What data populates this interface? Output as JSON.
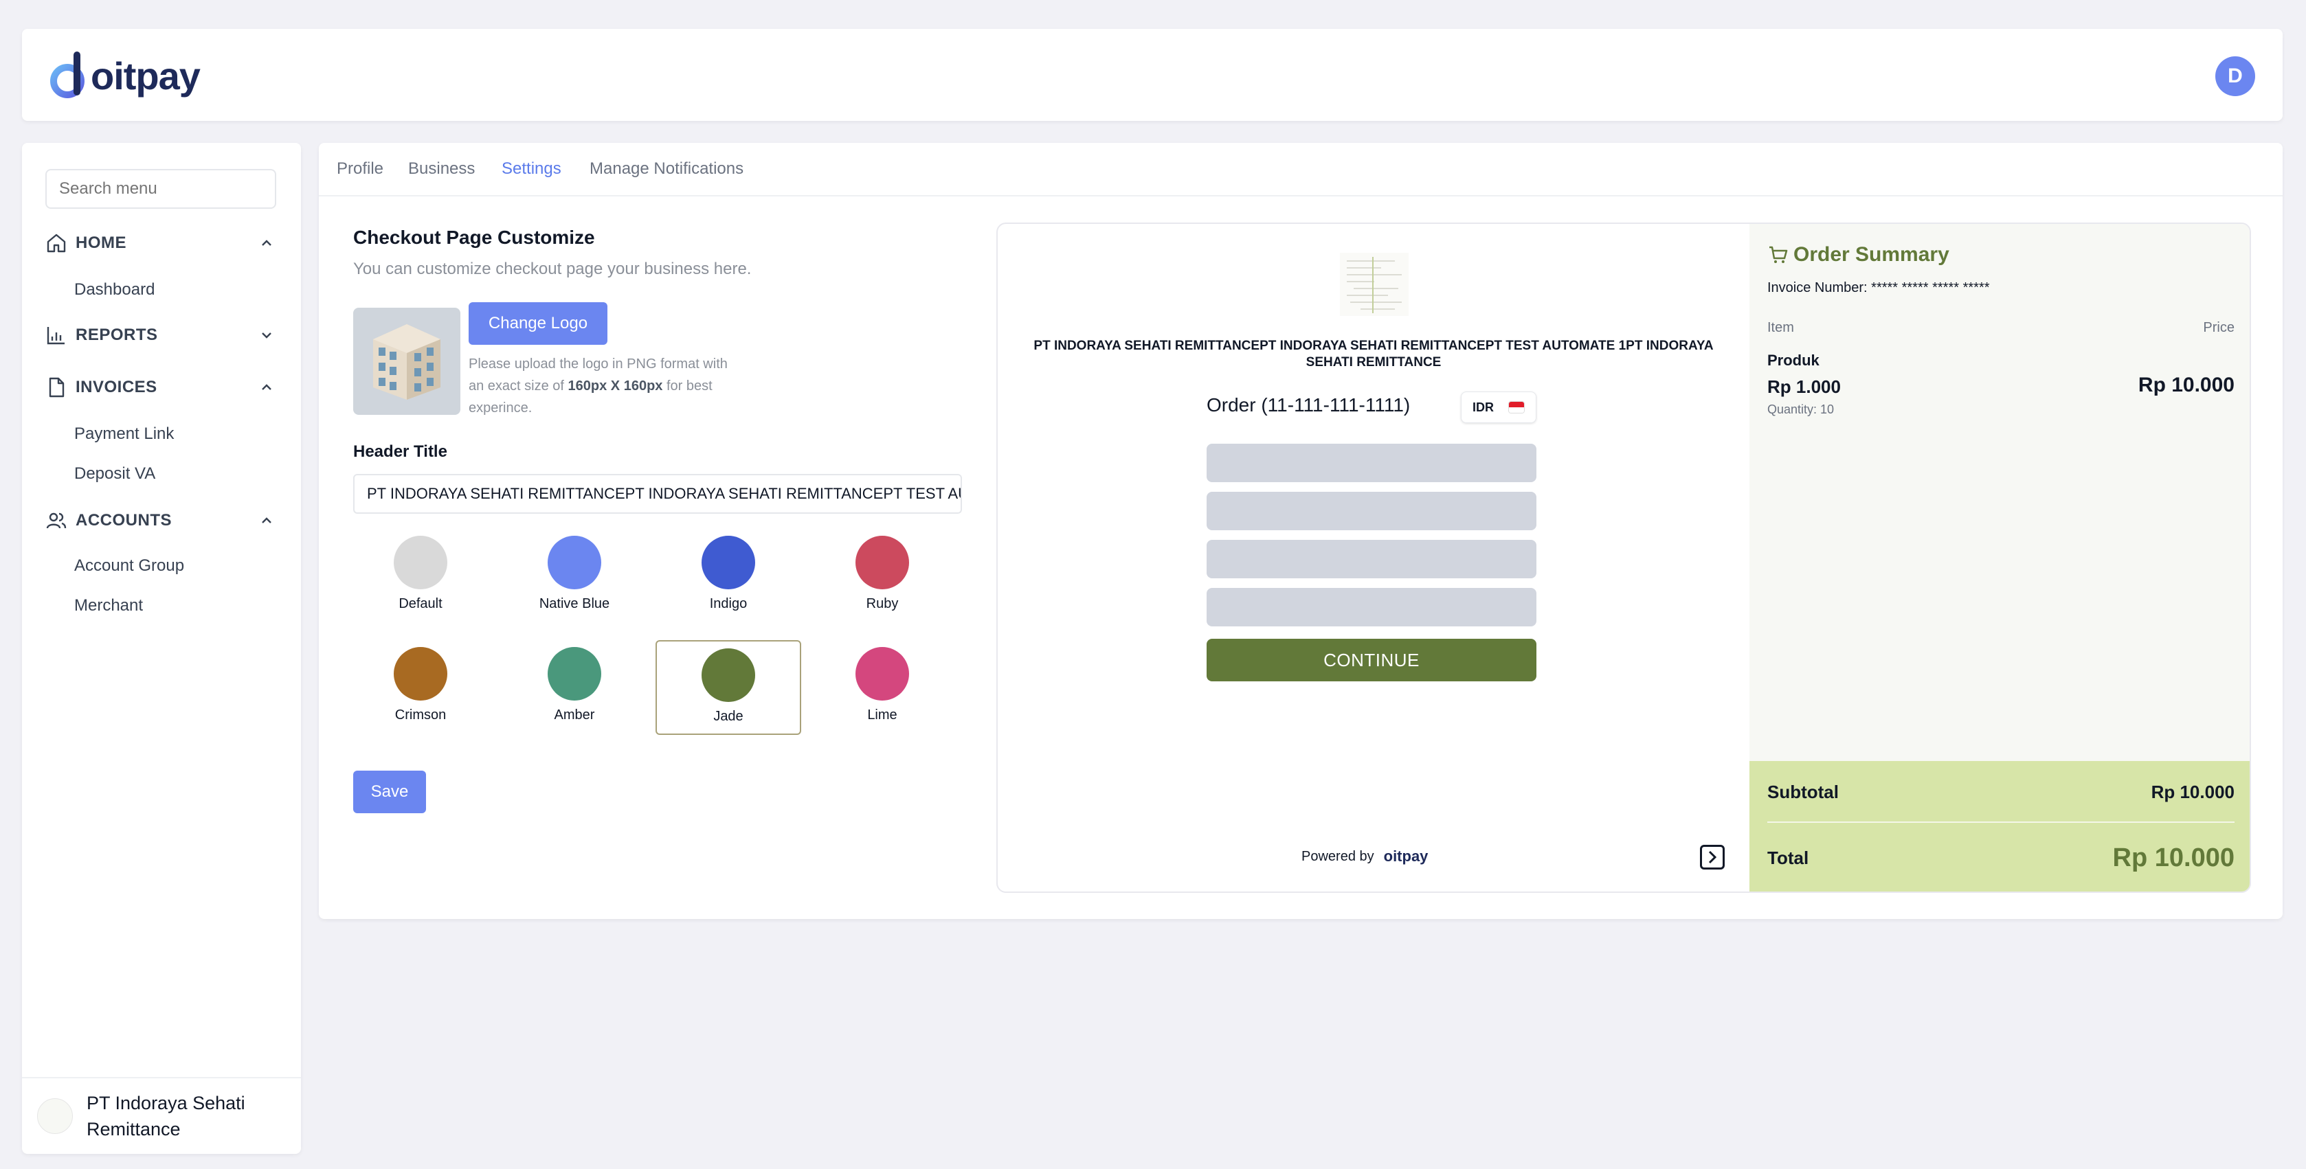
{
  "brand": {
    "name": "oitpay",
    "user_initial": "D"
  },
  "sidebar": {
    "search_placeholder": "Search menu",
    "sections": [
      {
        "label": "HOME",
        "items": [
          "Dashboard"
        ]
      },
      {
        "label": "REPORTS",
        "items": []
      },
      {
        "label": "INVOICES",
        "items": [
          "Payment Link",
          "Deposit VA"
        ]
      },
      {
        "label": "ACCOUNTS",
        "items": [
          "Account Group",
          "Merchant"
        ]
      }
    ],
    "footer_name_line1": "PT Indoraya Sehati",
    "footer_name_line2": "Remittance"
  },
  "tabs": [
    "Profile",
    "Business",
    "Settings",
    "Manage Notifications"
  ],
  "active_tab": "Settings",
  "customize": {
    "title": "Checkout Page Customize",
    "subtitle": "You can customize checkout page your business here.",
    "change_logo_label": "Change Logo",
    "hint_part1": "Please upload the logo in PNG format with an exact size of",
    "hint_bold": "160px X 160px",
    "hint_part2": "for best experince.",
    "header_title_label": "Header Title",
    "header_title_value": "PT INDORAYA SEHATI REMITTANCEPT INDORAYA SEHATI REMITTANCEPT TEST AUTOMATE 1PT INDORAYA SEHATI REMITTANCE",
    "save_label": "Save",
    "selected_theme": "Jade",
    "themes": [
      {
        "name": "Default",
        "color": "#d9d9d9"
      },
      {
        "name": "Native Blue",
        "color": "#6b86f0"
      },
      {
        "name": "Indigo",
        "color": "#3f5bd1"
      },
      {
        "name": "Ruby",
        "color": "#cc4a5e"
      },
      {
        "name": "Crimson",
        "color": "#a86a22"
      },
      {
        "name": "Amber",
        "color": "#4a987c"
      },
      {
        "name": "Jade",
        "color": "#627939"
      },
      {
        "name": "Lime",
        "color": "#d4477e"
      }
    ]
  },
  "preview": {
    "company": "PT INDORAYA SEHATI REMITTANCEPT INDORAYA SEHATI REMITTANCEPT TEST AUTOMATE 1PT INDORAYA SEHATI REMITTANCE",
    "order": "Order (11-111-111-1111)",
    "currency": "IDR",
    "continue_label": "CONTINUE",
    "powered_by": "Powered by",
    "powered_brand": "oitpay",
    "summary": {
      "title": "Order Summary",
      "invoice_label": "Invoice Number: ***** ***** ***** *****",
      "item_header": "Item",
      "price_header": "Price",
      "product_name": "Produk",
      "unit_price": "Rp 1.000",
      "quantity": "Quantity: 10",
      "line_total": "Rp 10.000",
      "subtotal_label": "Subtotal",
      "subtotal_value": "Rp 10.000",
      "total_label": "Total",
      "total_value": "Rp 10.000"
    },
    "accent": "#627939",
    "summary_bg": "#d7e5a8"
  }
}
